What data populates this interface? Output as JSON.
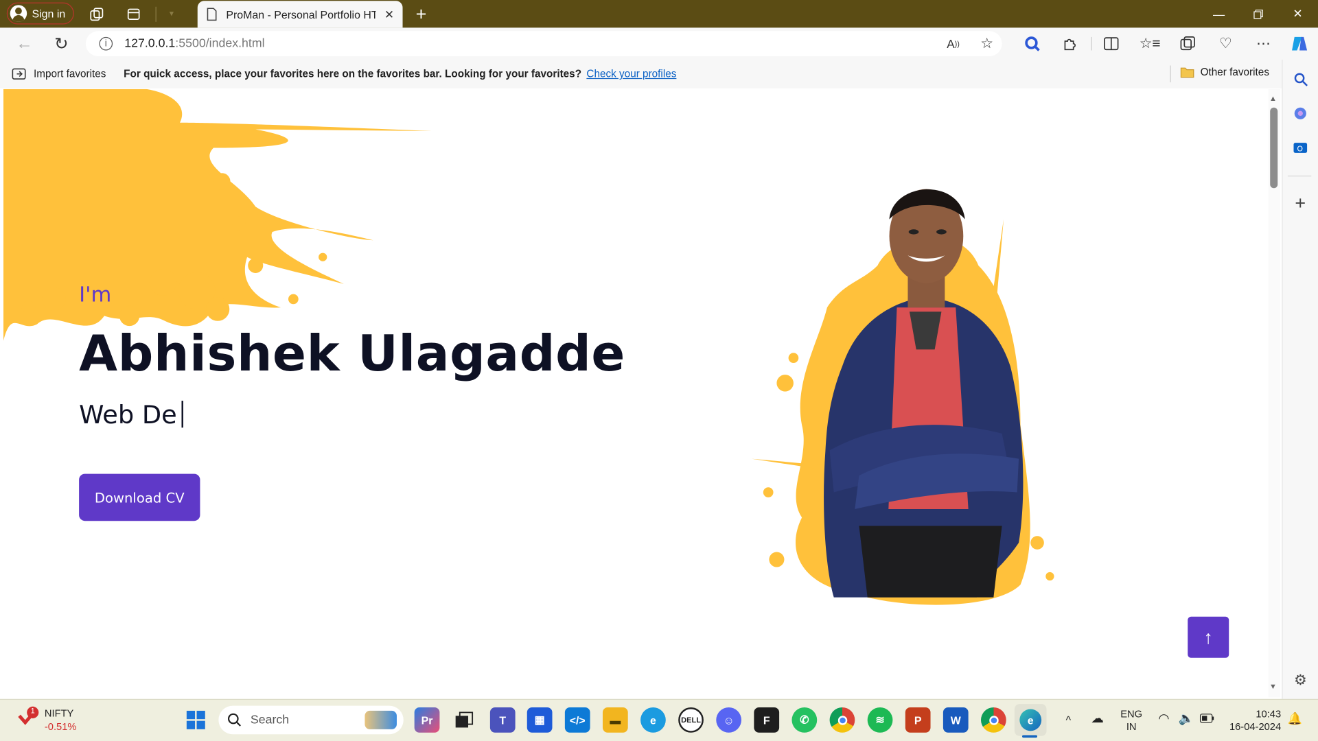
{
  "browser": {
    "signin_label": "Sign in",
    "tab_title": "ProMan - Personal Portfolio HTM",
    "url_host": "127.0.0.1",
    "url_rest": ":5500/index.html"
  },
  "favorites_bar": {
    "import_label": "Import favorites",
    "message": "For quick access, place your favorites here on the favorites bar. Looking for your favorites?",
    "link": "Check your profiles",
    "other": "Other favorites"
  },
  "hero": {
    "intro": "I'm",
    "name": "Abhishek Ulagadde",
    "role_typed": "Web De",
    "cta": "Download CV",
    "back_to_top": "↑"
  },
  "taskbar": {
    "stock_name": "NIFTY",
    "stock_change": "-0.51%",
    "stock_badge": "1",
    "search_placeholder": "Search",
    "lang_top": "ENG",
    "lang_bottom": "IN",
    "time": "10:43",
    "date": "16-04-2024"
  },
  "colors": {
    "accent": "#5f39c8",
    "splash": "#ffc13b",
    "titlebar": "#5b4c14"
  }
}
